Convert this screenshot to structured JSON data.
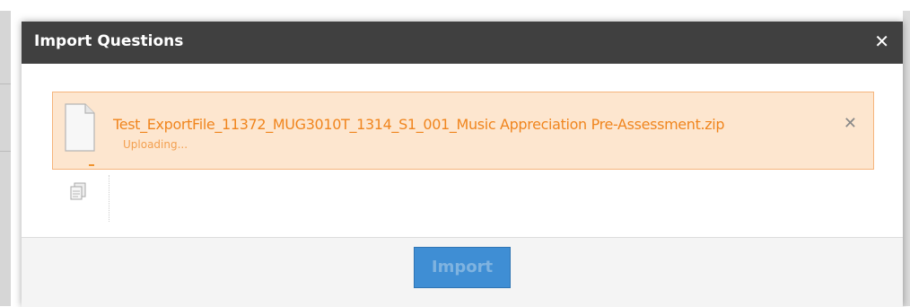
{
  "dialog": {
    "title": "Import Questions",
    "close_label": "✕"
  },
  "upload": {
    "file_name": "Test_ExportFile_11372_MUG3010T_1314_S1_001_Music Appreciation Pre-Assessment.zip",
    "status": "Uploading...",
    "remove_label": "✕",
    "file_icon": "document-icon"
  },
  "toolbar": {
    "icon": "import-file-icon"
  },
  "footer": {
    "import_label": "Import",
    "import_enabled": false
  },
  "colors": {
    "header_bg": "#404040",
    "upload_bg": "#fde6cf",
    "upload_border": "#f5b57c",
    "upload_text": "#f0851e",
    "button_bg": "#3f8ed4"
  }
}
